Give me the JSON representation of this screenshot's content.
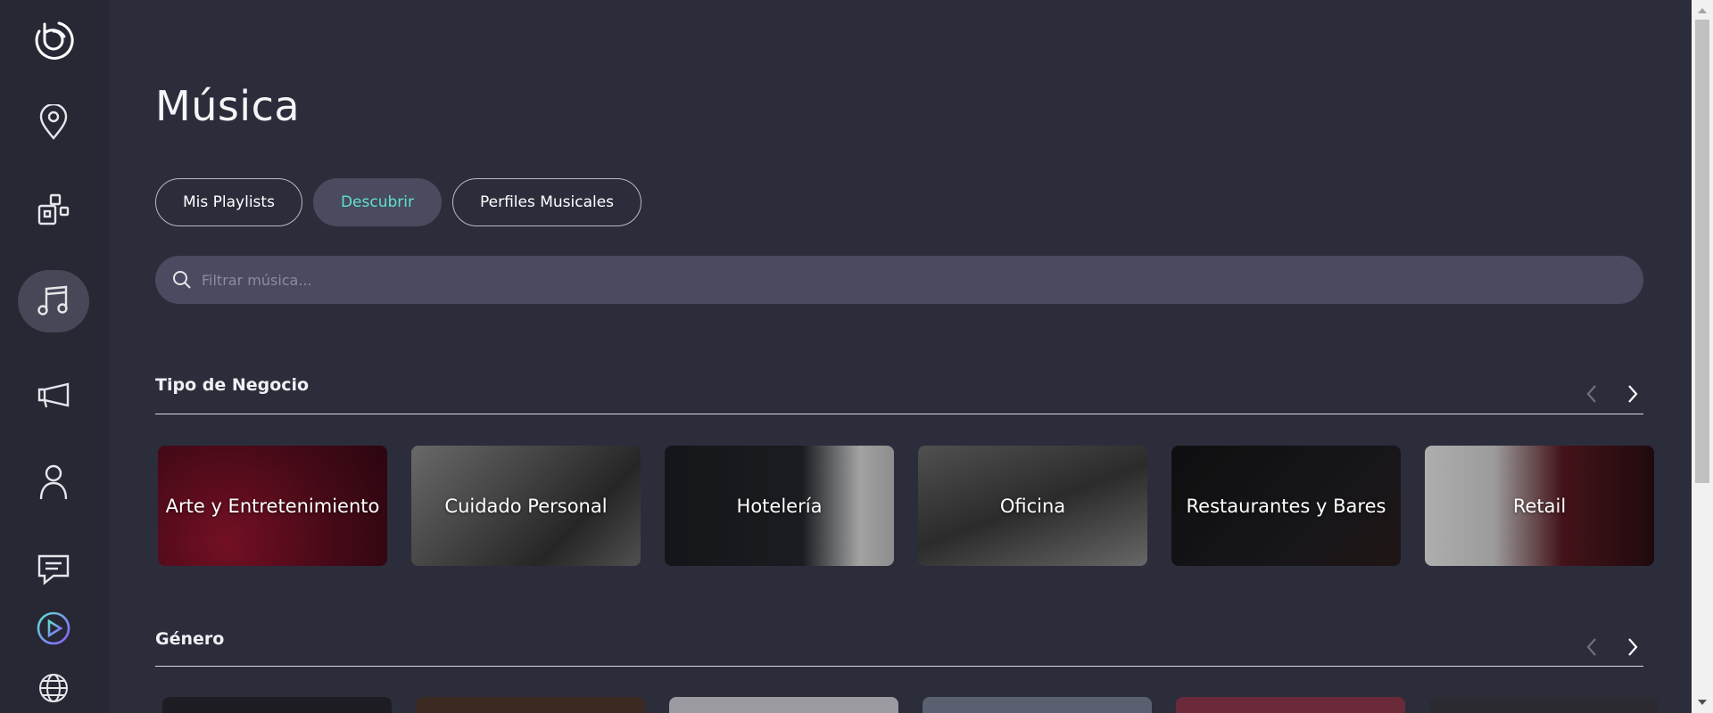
{
  "sidebar": {
    "items": [
      {
        "icon": "logo-icon"
      },
      {
        "icon": "location-pin-icon"
      },
      {
        "icon": "zones-icon"
      },
      {
        "icon": "music-note-icon",
        "active": true
      },
      {
        "icon": "megaphone-icon"
      },
      {
        "icon": "user-icon"
      },
      {
        "icon": "chat-icon"
      },
      {
        "icon": "play-circle-icon"
      },
      {
        "icon": "globe-icon"
      }
    ]
  },
  "page": {
    "title": "Música"
  },
  "tabs": [
    {
      "label": "Mis Playlists",
      "active": false
    },
    {
      "label": "Descubrir",
      "active": true
    },
    {
      "label": "Perfiles Musicales",
      "active": false
    }
  ],
  "search": {
    "placeholder": "Filtrar música..."
  },
  "sections": [
    {
      "title": "Tipo de Negocio",
      "cards": [
        {
          "label": "Arte y Entretenimiento"
        },
        {
          "label": "Cuidado Personal"
        },
        {
          "label": "Hotelería"
        },
        {
          "label": "Oficina"
        },
        {
          "label": "Restaurantes y Bares"
        },
        {
          "label": "Retail"
        }
      ]
    },
    {
      "title": "Género"
    }
  ],
  "colors": {
    "background": "#2c2d3b",
    "sidebar": "#272834",
    "accent": "#5fe0d0",
    "search_bg": "#4a4a60"
  }
}
